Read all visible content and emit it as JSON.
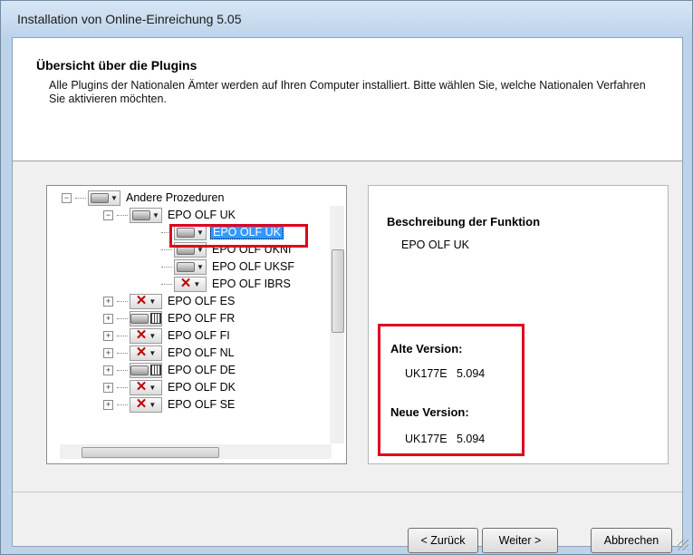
{
  "window": {
    "title": "Installation von Online-Einreichung 5.05"
  },
  "header": {
    "title": "Übersicht über die Plugins",
    "description": "Alle Plugins der Nationalen Ämter werden auf Ihren Computer installiert. Bitte wählen Sie, welche Nationalen Verfahren Sie aktivieren möchten."
  },
  "tree": {
    "items": [
      {
        "label": "Andere Prozeduren",
        "expander": "−",
        "status": "plugin-icon"
      },
      {
        "label": "EPO OLF UK",
        "expander": "−",
        "status": "plugin-icon"
      },
      {
        "label": "EPO OLF UK",
        "status": "plugin-icon",
        "selected": true
      },
      {
        "label": "EPO OLF UKNI",
        "status": "plugin-icon"
      },
      {
        "label": "EPO OLF UKSF",
        "status": "plugin-icon"
      },
      {
        "label": "EPO OLF IBRS",
        "status": "x-icon"
      },
      {
        "label": "EPO OLF ES",
        "expander": "+",
        "status": "x-icon"
      },
      {
        "label": "EPO OLF FR",
        "expander": "+",
        "status": "plugin-grid-icon"
      },
      {
        "label": "EPO OLF FI",
        "expander": "+",
        "status": "x-icon"
      },
      {
        "label": "EPO OLF NL",
        "expander": "+",
        "status": "x-icon"
      },
      {
        "label": "EPO OLF DE",
        "expander": "+",
        "status": "plugin-grid-icon"
      },
      {
        "label": "EPO OLF DK",
        "expander": "+",
        "status": "x-icon"
      },
      {
        "label": "EPO OLF SE",
        "expander": "+",
        "status": "x-icon"
      }
    ]
  },
  "details": {
    "description_label": "Beschreibung der Funktion",
    "description_value": "EPO OLF UK",
    "old_version_label": "Alte Version:",
    "old_version_value": "UK177E   5.094",
    "new_version_label": "Neue Version:",
    "new_version_value": "UK177E   5.094"
  },
  "buttons": {
    "back": "< Zurück",
    "next": "Weiter >",
    "cancel": "Abbrechen"
  },
  "highlight_color": "#e0001b",
  "selection_color": "#3399ff"
}
